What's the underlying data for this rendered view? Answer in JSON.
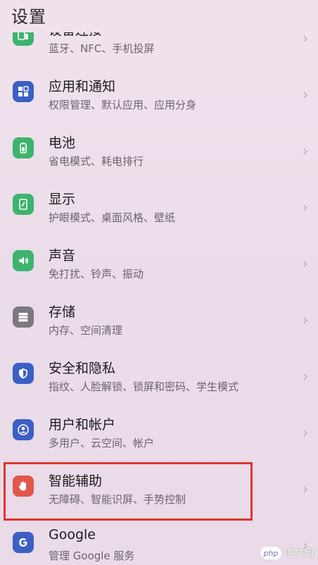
{
  "header": {
    "title": "设置"
  },
  "items": [
    {
      "title": "设备连接",
      "subtitle": "蓝牙、NFC、手机投屏",
      "icon": "device-connection-icon",
      "color": "#3db46d"
    },
    {
      "title": "应用和通知",
      "subtitle": "权限管理、默认应用、应用分身",
      "icon": "apps-grid-icon",
      "color": "#3b5fc4"
    },
    {
      "title": "电池",
      "subtitle": "省电模式、耗电排行",
      "icon": "battery-icon",
      "color": "#3db46d"
    },
    {
      "title": "显示",
      "subtitle": "护眼模式、桌面风格、壁纸",
      "icon": "display-icon",
      "color": "#3db46d"
    },
    {
      "title": "声音",
      "subtitle": "免打扰、铃声、振动",
      "icon": "speaker-icon",
      "color": "#3db46d"
    },
    {
      "title": "存储",
      "subtitle": "内存、空间清理",
      "icon": "storage-icon",
      "color": "#7d7880"
    },
    {
      "title": "安全和隐私",
      "subtitle": "指纹、人脸解锁、锁屏和密码、学生模式",
      "icon": "shield-icon",
      "color": "#3b5fc4"
    },
    {
      "title": "用户和帐户",
      "subtitle": "多用户、云空间、帐户",
      "icon": "user-icon",
      "color": "#3b5fc4"
    },
    {
      "title": "智能辅助",
      "subtitle": "无障碍、智能识屏、手势控制",
      "icon": "hand-icon",
      "color": "#e2574c"
    },
    {
      "title": "Google",
      "subtitle": "管理 Google 服务",
      "icon": "google-icon",
      "color": "#3b5fc4"
    }
  ],
  "chevron": "›",
  "watermark": {
    "logo": "php",
    "text": "中文网"
  }
}
